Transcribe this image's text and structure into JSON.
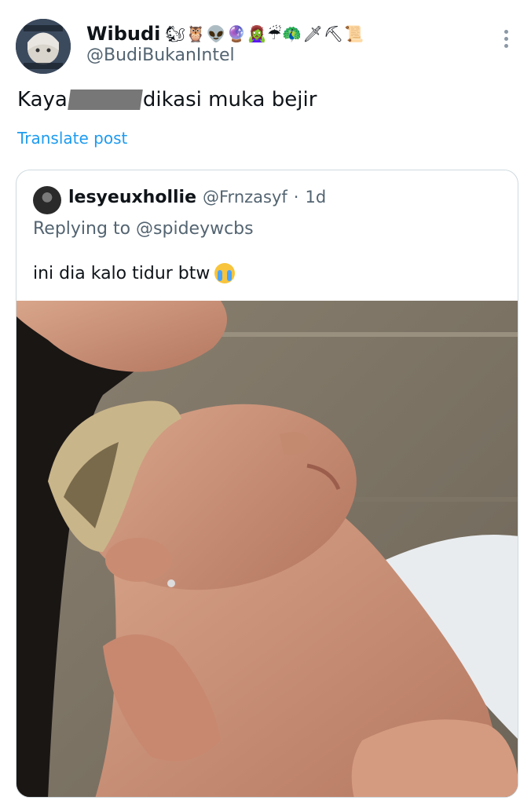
{
  "author": {
    "display_name": "Wibudi",
    "emojis": "🐿🦉👽🔮🧟‍♀️☔🦚🗡⛏📜",
    "handle": "@BudiBukanIntel",
    "avatar_icon": "anime-avatar-icon"
  },
  "post": {
    "text_before": "Kaya ",
    "text_after": " dikasi muka bejir",
    "translate_label": "Translate post"
  },
  "quote": {
    "display_name": "lesyeuxhollie",
    "handle": "@Frnzasyf",
    "separator": "·",
    "time": "1d",
    "replying_prefix": "Replying to ",
    "replying_mention": "@spideywcbs",
    "text": "ini dia kalo tidur btw",
    "emoji_icon": "loudly-crying-face-icon"
  },
  "colors": {
    "link": "#1d9bf0",
    "secondary_text": "#536471",
    "border": "#cfd9de"
  }
}
